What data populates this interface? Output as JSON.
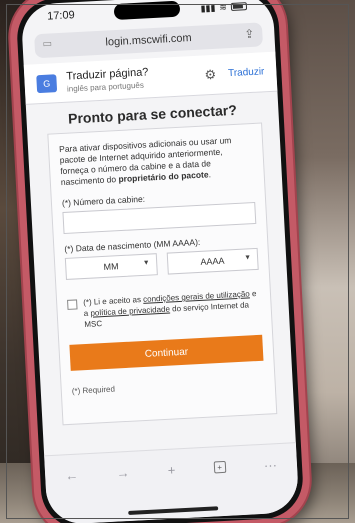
{
  "status_bar": {
    "time": "17:09"
  },
  "browser": {
    "url": "login.mscwifi.com"
  },
  "translate_banner": {
    "title": "Traduzir página?",
    "subtitle": "inglês para português",
    "action_label": "Traduzir"
  },
  "page": {
    "title": "Pronto para se conectar?",
    "intro_text_1": "Para ativar dispositivos adicionais ou usar um pacote de Internet adquirido anteriormente, forneça o número da cabine e a data de nascimento do ",
    "intro_text_bold": "proprietário do pacote",
    "intro_text_2": ".",
    "cabin_label": "(*) Número da cabine:",
    "cabin_value": "",
    "dob_label": "(*) Data de nascimento (MM AAAA):",
    "month_value": "MM",
    "year_value": "AAAA",
    "terms_prefix": "(*) Li e aceito as ",
    "terms_link_1": "condições gerais de utilização",
    "terms_middle": " e a ",
    "terms_link_2": "política de privacidade",
    "terms_suffix": " do serviço Internet da MSC",
    "continue_label": "Continuar",
    "required_note": "(*) Required"
  }
}
